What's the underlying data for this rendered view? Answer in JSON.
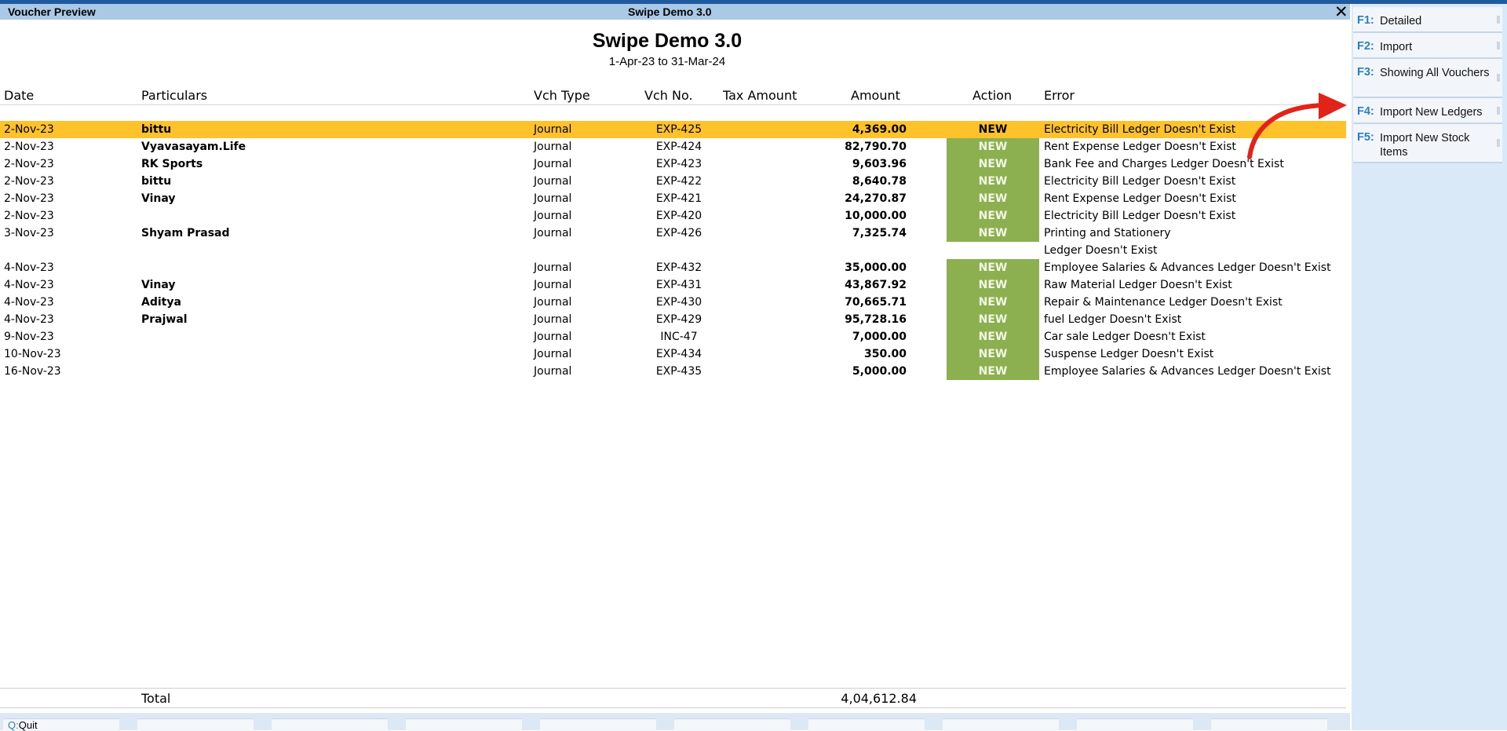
{
  "window": {
    "title_left": "Voucher Preview",
    "title_center": "Swipe Demo 3.0",
    "close_label": "✕"
  },
  "report": {
    "company": "Swipe Demo 3.0",
    "period": "1-Apr-23 to 31-Mar-24"
  },
  "columns": {
    "date": "Date",
    "particulars": "Particulars",
    "vch_type": "Vch Type",
    "vch_no": "Vch No.",
    "tax_amount": "Tax Amount",
    "amount": "Amount",
    "action": "Action",
    "error": "Error"
  },
  "rows": [
    {
      "date": "2-Nov-23",
      "particulars": "bittu",
      "vch_type": "Journal",
      "vch_no": "EXP-425",
      "amount": "4,369.00",
      "action": "NEW",
      "error": "Electricity Bill Ledger Doesn't Exist",
      "selected": true
    },
    {
      "date": "2-Nov-23",
      "particulars": "Vyavasayam.Life",
      "vch_type": "Journal",
      "vch_no": "EXP-424",
      "amount": "82,790.70",
      "action": "NEW",
      "error": "Rent Expense Ledger Doesn't Exist"
    },
    {
      "date": "2-Nov-23",
      "particulars": "RK Sports",
      "vch_type": "Journal",
      "vch_no": "EXP-423",
      "amount": "9,603.96",
      "action": "NEW",
      "error": "Bank Fee and Charges Ledger Doesn't Exist"
    },
    {
      "date": "2-Nov-23",
      "particulars": "bittu",
      "vch_type": "Journal",
      "vch_no": "EXP-422",
      "amount": "8,640.78",
      "action": "NEW",
      "error": "Electricity Bill Ledger Doesn't Exist"
    },
    {
      "date": "2-Nov-23",
      "particulars": "Vinay",
      "vch_type": "Journal",
      "vch_no": "EXP-421",
      "amount": "24,270.87",
      "action": "NEW",
      "error": "Rent Expense Ledger Doesn't Exist"
    },
    {
      "date": "2-Nov-23",
      "particulars": "",
      "vch_type": "Journal",
      "vch_no": "EXP-420",
      "amount": "10,000.00",
      "action": "NEW",
      "error": "Electricity Bill Ledger Doesn't Exist"
    },
    {
      "date": "3-Nov-23",
      "particulars": "Shyam Prasad",
      "vch_type": "Journal",
      "vch_no": "EXP-426",
      "amount": "7,325.74",
      "action": "NEW",
      "error": "Printing and Stationery",
      "error2": " Ledger Doesn't Exist"
    },
    {
      "date": "4-Nov-23",
      "particulars": "",
      "vch_type": "Journal",
      "vch_no": "EXP-432",
      "amount": "35,000.00",
      "action": "NEW",
      "error": "Employee Salaries & Advances Ledger Doesn't Exist"
    },
    {
      "date": "4-Nov-23",
      "particulars": "Vinay",
      "vch_type": "Journal",
      "vch_no": "EXP-431",
      "amount": "43,867.92",
      "action": "NEW",
      "error": "Raw Material Ledger Doesn't Exist"
    },
    {
      "date": "4-Nov-23",
      "particulars": "Aditya",
      "vch_type": "Journal",
      "vch_no": "EXP-430",
      "amount": "70,665.71",
      "action": "NEW",
      "error": "Repair & Maintenance Ledger Doesn't Exist"
    },
    {
      "date": "4-Nov-23",
      "particulars": "Prajwal",
      "vch_type": "Journal",
      "vch_no": "EXP-429",
      "amount": "95,728.16",
      "action": "NEW",
      "error": "fuel Ledger Doesn't Exist"
    },
    {
      "date": "9-Nov-23",
      "particulars": "",
      "vch_type": "Journal",
      "vch_no": "INC-47",
      "amount": "7,000.00",
      "action": "NEW",
      "error": "Car sale Ledger Doesn't Exist"
    },
    {
      "date": "10-Nov-23",
      "particulars": "",
      "vch_type": "Journal",
      "vch_no": "EXP-434",
      "amount": "350.00",
      "action": "NEW",
      "error": "Suspense Ledger Doesn't Exist"
    },
    {
      "date": "16-Nov-23",
      "particulars": "",
      "vch_type": "Journal",
      "vch_no": "EXP-435",
      "amount": "5,000.00",
      "action": "NEW",
      "error": "Employee Salaries & Advances Ledger Doesn't Exist"
    }
  ],
  "total": {
    "label": "Total",
    "value": "4,04,612.84"
  },
  "sidebar": [
    {
      "key": "F1:",
      "label": "Detailed"
    },
    {
      "key": "F2:",
      "label": "Import"
    },
    {
      "key": "F3:",
      "label": "Showing All Vouchers"
    },
    {
      "key": "F4:",
      "label": "Import New Ledgers"
    },
    {
      "key": "F5:",
      "label": "Import New Stock Items"
    }
  ],
  "bottombar": {
    "quit_key": "Q:",
    "quit_label": "Quit"
  },
  "colors": {
    "selected_row": "#ffc22b",
    "action_badge": "#8cb050",
    "title_bar": "#a9c9e6",
    "key_accent": "#2a7ec5",
    "annotation_arrow": "#e2231a"
  }
}
